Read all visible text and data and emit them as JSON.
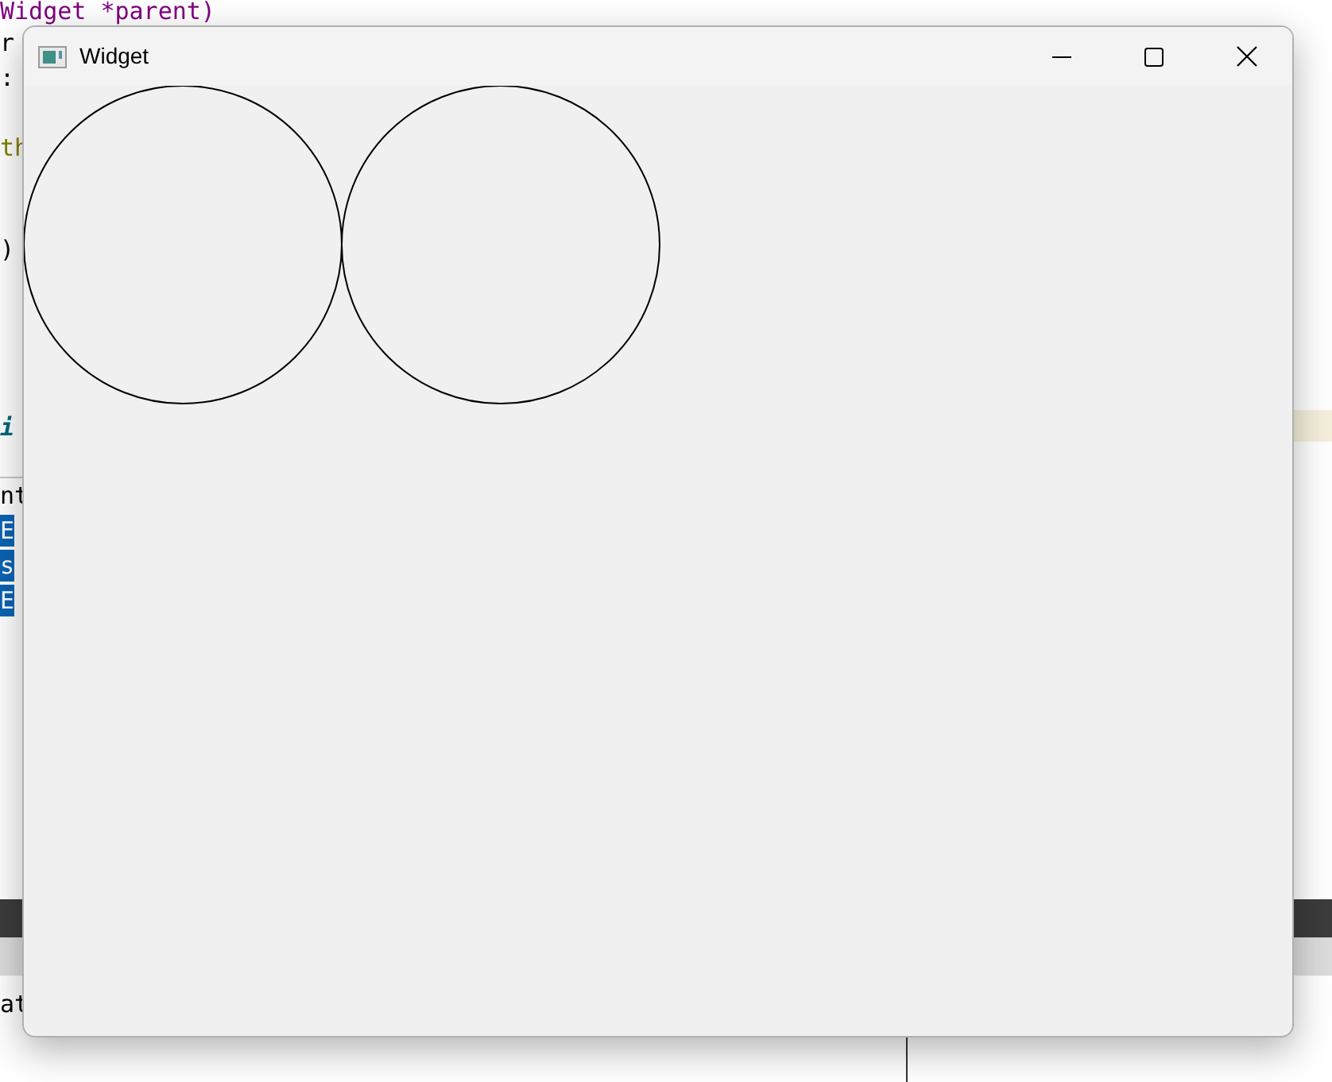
{
  "background_editor": {
    "lines": [
      {
        "text": "Widget *parent)",
        "kind": "type",
        "selected": false
      },
      {
        "text": "r",
        "kind": "plain",
        "selected": false
      },
      {
        "text": ":",
        "kind": "plain",
        "selected": false
      },
      {
        "text": "th",
        "kind": "keyword",
        "selected": false
      },
      {
        "text": ")",
        "kind": "plain",
        "selected": false
      },
      {
        "text": "i",
        "kind": "emphasis",
        "selected": false
      },
      {
        "text": "nt",
        "kind": "plain",
        "selected": false
      },
      {
        "text": "E",
        "selected": true
      },
      {
        "text": "s",
        "selected": true
      },
      {
        "text": "E",
        "selected": true
      },
      {
        "text": "at",
        "kind": "plain",
        "selected": false
      }
    ]
  },
  "window": {
    "title": "Widget"
  }
}
